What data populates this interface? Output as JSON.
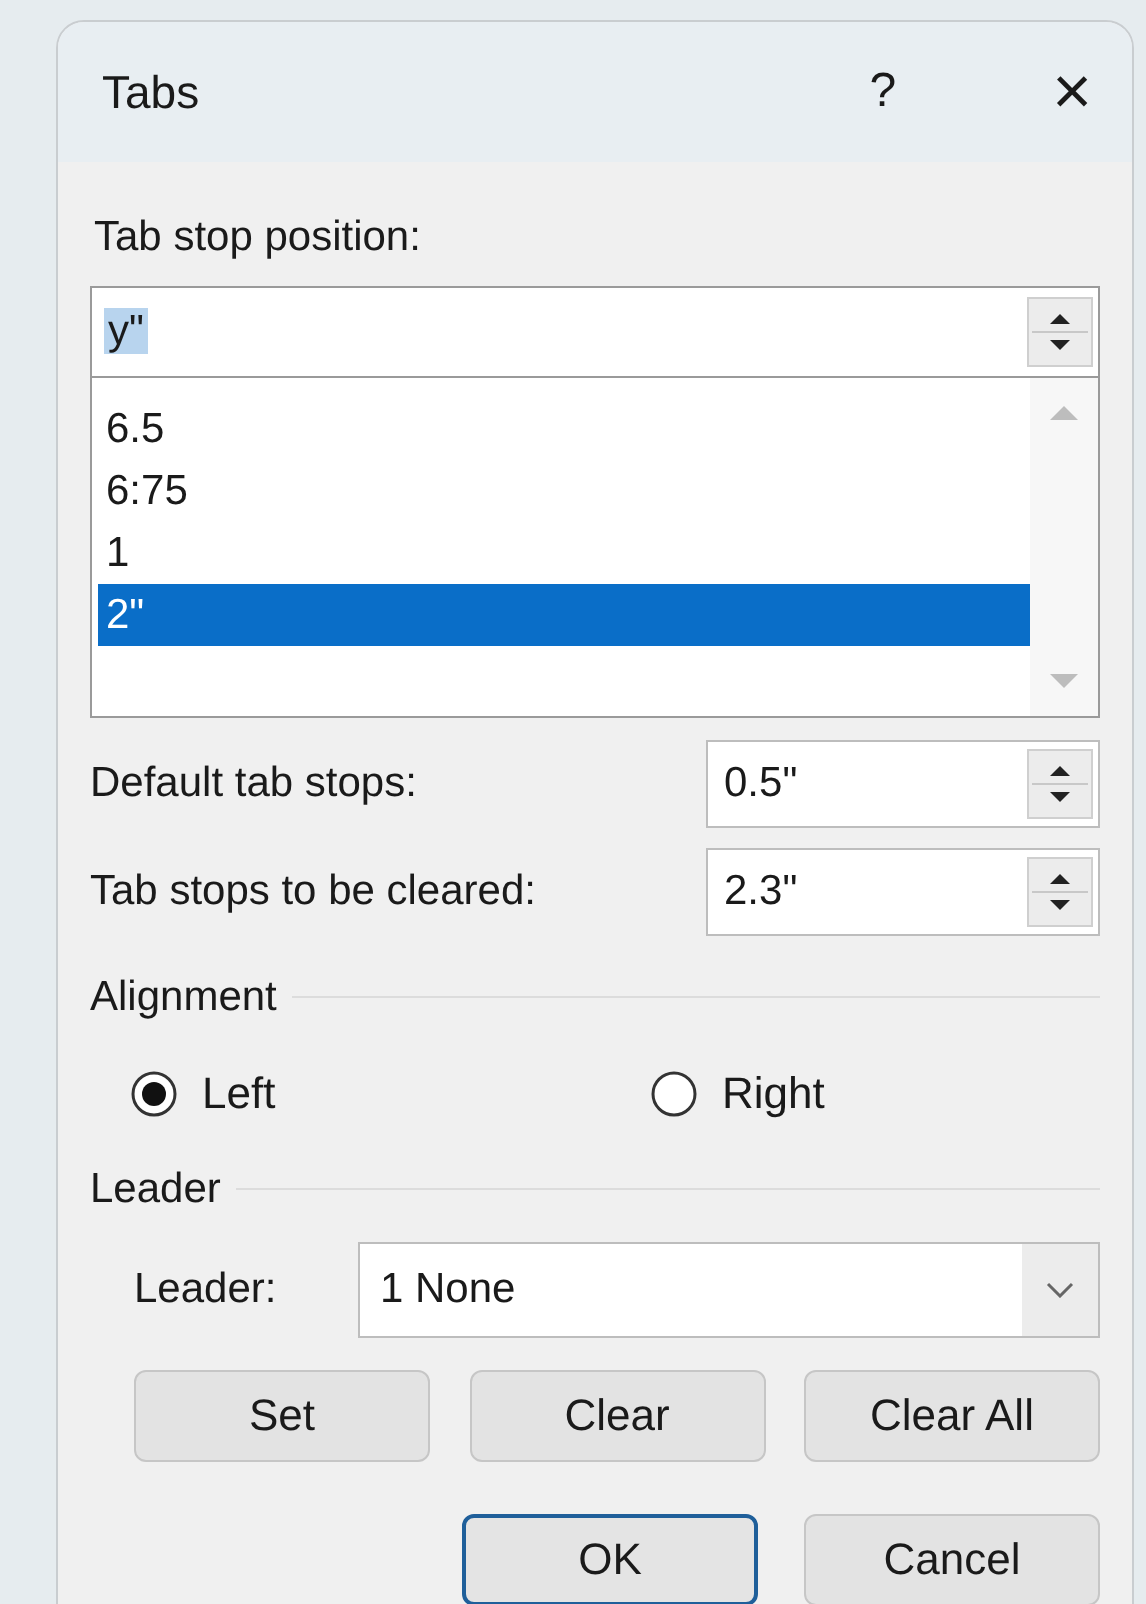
{
  "window": {
    "title": "Tabs",
    "help": "?",
    "close": "×"
  },
  "tab_stop_position": {
    "label": "Tab stop position:",
    "value": "y\"",
    "items": [
      {
        "text": "6.5",
        "selected": false
      },
      {
        "text": "6:75",
        "selected": false
      },
      {
        "text": "1",
        "selected": false
      },
      {
        "text": "2\"",
        "selected": true
      }
    ]
  },
  "default_tab_stops": {
    "label": "Default tab stops:",
    "value": "0.5\""
  },
  "tab_stops_to_be_cleared": {
    "label": "Tab stops to be cleared:",
    "value": "2.3\""
  },
  "alignment": {
    "title": "Alignment",
    "options": [
      {
        "label": "Left",
        "selected": true
      },
      {
        "label": "Right",
        "selected": false
      }
    ]
  },
  "leader": {
    "title": "Leader",
    "label": "Leader:",
    "value": "1 None"
  },
  "buttons": [
    {
      "label": "Set",
      "default": false
    },
    {
      "label": "Clear",
      "default": false
    },
    {
      "label": "Clear All",
      "default": false
    }
  ],
  "footer_buttons": [
    {
      "label": "OK",
      "default": true
    },
    {
      "label": "Cancel",
      "default": false
    }
  ]
}
